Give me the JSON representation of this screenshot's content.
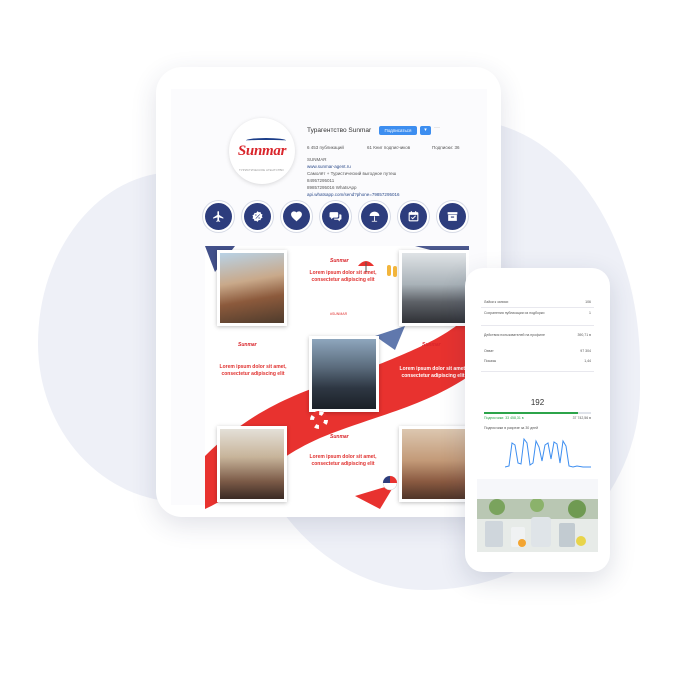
{
  "profile": {
    "username": "Турагентство Sunmar",
    "follow_label": "Подписаться",
    "dropdown_label": "▾",
    "more_label": "···",
    "stats": {
      "posts": "6 453 публикаций",
      "followers": "61 Книг подписчиков",
      "following": "Подписки: 36"
    },
    "bio_lines": [
      "SUNMAR",
      "www.sunmar-agent.ru",
      "Самолёт + Туристический выгодное путеш",
      "84957295011",
      "89857295016 WhatsApp",
      "api.whatsapp.com/send?phone=79857295016"
    ],
    "logo_text": "Sunmar",
    "logo_sub": "ТУРИСТИЧЕСКОЕ АГЕНТСТВО"
  },
  "highlights": [
    {
      "icon": "airplane-icon"
    },
    {
      "icon": "percent-badge-icon"
    },
    {
      "icon": "heart-icon"
    },
    {
      "icon": "chat-bubbles-icon"
    },
    {
      "icon": "beach-umbrella-icon"
    },
    {
      "icon": "calendar-check-icon"
    },
    {
      "icon": "archive-box-icon"
    }
  ],
  "feed": {
    "posts": [
      {
        "text": "Lorem ipsum dolor sit amet, consectetur adipiscing elit"
      },
      {
        "text": "Lorem ipsum dolor sit amet, consectetur adipiscing elit"
      },
      {
        "text": "Lorem ipsum dolor sit amet, consectetur adipiscing elit"
      },
      {
        "text": "Lorem ipsum dolor sit amet, consectetur adipiscing elit"
      }
    ],
    "tag": "#SUNMAR",
    "logo_small": "Sunmar"
  },
  "stats_panel": {
    "rows": [
      {
        "label": "Лайки к записи",
        "value": "106"
      },
      {
        "label": "Сохранения публикации из подборки",
        "value": "1"
      },
      {
        "label": "Действия пользователей на профиле",
        "value": "390,71 в"
      },
      {
        "label": "Охват",
        "value": "97 304"
      },
      {
        "label": "Показы",
        "value": "1,44"
      }
    ],
    "big_value": "192",
    "progress_label_left": "Подписчики: 33 458,31 в",
    "progress_label_right": "37 742,56 в",
    "progress": 0.88,
    "chart_caption": "Подписчики в разрезе за 30 дней"
  },
  "colors": {
    "navy": "#2d3d7d",
    "red": "#e0312f",
    "follow_blue": "#3d8ef0",
    "green": "#2ca44a"
  }
}
